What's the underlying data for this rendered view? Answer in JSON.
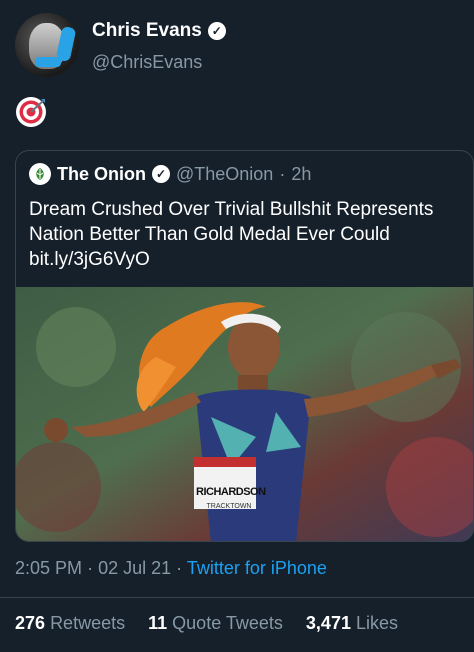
{
  "tweet": {
    "author_name": "Chris Evans",
    "author_handle": "@ChrisEvans",
    "emoji": "🎯"
  },
  "quoted": {
    "author_name": "The Onion",
    "author_handle": "@TheOnion",
    "separator": "·",
    "age": "2h",
    "text": "Dream Crushed Over Trivial Bullshit Represents Nation Better Than Gold Medal Ever Could bit.ly/3jG6VyO",
    "photo": {
      "bib_name": "RICHARDSON",
      "bib_sub": "TRACKTOWN"
    }
  },
  "meta": {
    "time": "2:05 PM",
    "separator": "·",
    "date": "02 Jul 21",
    "separator2": "·",
    "source": "Twitter for iPhone"
  },
  "stats": {
    "retweets_count": "276",
    "retweets_label": "Retweets",
    "quotes_count": "11",
    "quotes_label": "Quote Tweets",
    "likes_count": "3,471",
    "likes_label": "Likes"
  },
  "colors": {
    "background": "#15202b",
    "secondary_text": "#8899a6",
    "link": "#1da1f2",
    "border": "#38444d"
  }
}
